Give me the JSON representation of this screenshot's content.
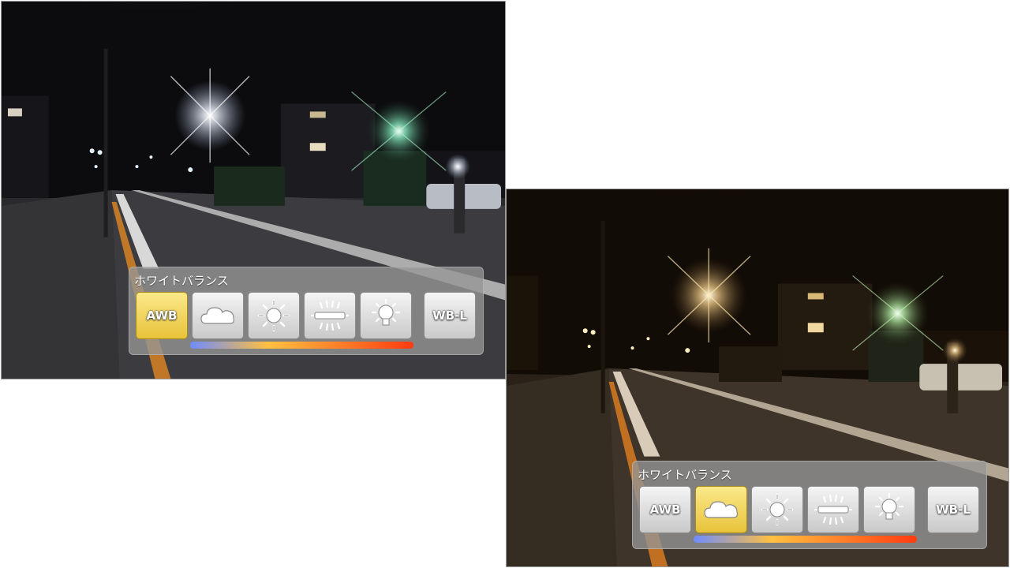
{
  "colors": {
    "selected_button": "#f0d25a",
    "button": "#dcdcdc",
    "panel": "#969696",
    "temp_cool": "#6e8cff",
    "temp_warm": "#ff3b10"
  },
  "screens": [
    {
      "panel": {
        "title": "ホワイトバランス",
        "buttons": [
          {
            "label": "AWB",
            "icon": "auto-white-balance-icon",
            "selected": true
          },
          {
            "label": "",
            "icon": "cloud-icon",
            "selected": false
          },
          {
            "label": "",
            "icon": "sun-icon",
            "selected": false
          },
          {
            "label": "",
            "icon": "fluorescent-icon",
            "selected": false
          },
          {
            "label": "",
            "icon": "incandescent-bulb-icon",
            "selected": false
          },
          {
            "label": "WB-L",
            "icon": "wb-lock-icon",
            "selected": false
          }
        ],
        "temperature_scale": "cool-to-warm"
      }
    },
    {
      "panel": {
        "title": "ホワイトバランス",
        "buttons": [
          {
            "label": "AWB",
            "icon": "auto-white-balance-icon",
            "selected": false
          },
          {
            "label": "",
            "icon": "cloud-icon",
            "selected": true
          },
          {
            "label": "",
            "icon": "sun-icon",
            "selected": false
          },
          {
            "label": "",
            "icon": "fluorescent-icon",
            "selected": false
          },
          {
            "label": "",
            "icon": "incandescent-bulb-icon",
            "selected": false
          },
          {
            "label": "WB-L",
            "icon": "wb-lock-icon",
            "selected": false
          }
        ],
        "temperature_scale": "cool-to-warm"
      }
    }
  ]
}
